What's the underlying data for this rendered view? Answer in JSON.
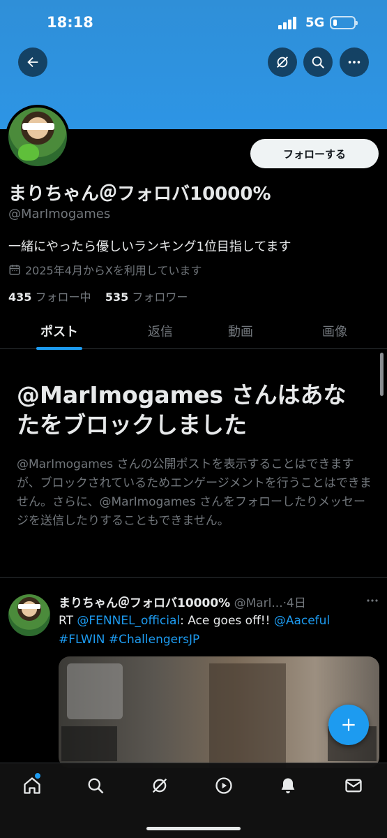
{
  "status_bar": {
    "time": "18:18",
    "network": "5G"
  },
  "profile": {
    "display_name": "まりちゃん＠フォロバ10000%",
    "handle": "@MarImogames",
    "bio": "一緒にやったら優しいランキング1位目指してます",
    "joined": "2025年4月からXを利用しています",
    "following_count": "435",
    "following_label": "フォロー中",
    "followers_count": "535",
    "followers_label": "フォロワー",
    "follow_button": "フォローする"
  },
  "tabs": [
    {
      "label": "ポスト"
    },
    {
      "label": "返信"
    },
    {
      "label": "動画"
    },
    {
      "label": "画像"
    }
  ],
  "blocked": {
    "title": "@MarImogames さんはあなたをブロックしました",
    "description": "@MarImogames さんの公開ポストを表示することはできますが、ブロックされているためエンゲージメントを行うことはできません。さらに、@MarImogames さんをフォローしたりメッセージを送信したりすることもできません。"
  },
  "post": {
    "author_name": "まりちゃん＠フォロバ10000%",
    "author_handle": "@Marl...",
    "time": "·4日",
    "text_prefix": "RT ",
    "mention_1": "@FENNEL_official",
    "text_middle": ": Ace goes off!! ",
    "mention_2": "@Aaceful",
    "tags": "#FLWIN #ChallengersJP"
  },
  "icons": {
    "back": "arrow-left-icon",
    "grok": "grok-icon",
    "search": "search-icon",
    "more": "more-horizontal-icon",
    "calendar": "calendar-icon",
    "compose": "plus-icon",
    "nav": [
      "home-icon",
      "search-icon",
      "grok-icon",
      "video-icon",
      "bell-icon",
      "mail-icon"
    ]
  },
  "colors": {
    "accent": "#1d9bf0",
    "banner": "#2d95e5",
    "background": "#000000"
  }
}
